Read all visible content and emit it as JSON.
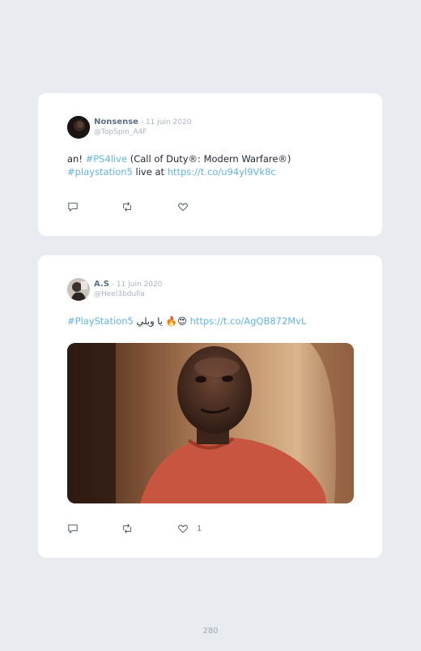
{
  "tweets": [
    {
      "author": "Nonsense",
      "separator": " - ",
      "date": "11 juin 2020",
      "handle": "@TopSpin_A4F",
      "line1": {
        "t1": "an! ",
        "tag1": "#PS4live",
        "t2": " (Call of Duty®: Modern Warfare®)"
      },
      "line2": {
        "tag1": "#playstation5",
        "t1": " live at ",
        "link": "https://t.co/u94yl9Vk8c"
      },
      "likes": ""
    },
    {
      "author": "A.S",
      "separator": " - ",
      "date": "11 juin 2020",
      "handle": "@Heel3bdulla",
      "line1": {
        "tag1": "#PlayStation5",
        "t1": " يا ويلي 🔥😍 ",
        "link": "https://t.co/AgQB872MvL"
      },
      "likes": "1"
    }
  ],
  "icons": {
    "reply": "comment-icon",
    "retweet": "retweet-icon",
    "like": "heart-icon"
  },
  "colors": {
    "background": "#e8ebf0",
    "card": "#ffffff",
    "accent": "#63b3e6",
    "author": "#5b6e84",
    "muted": "#a9b4c1"
  },
  "page_number": "280"
}
